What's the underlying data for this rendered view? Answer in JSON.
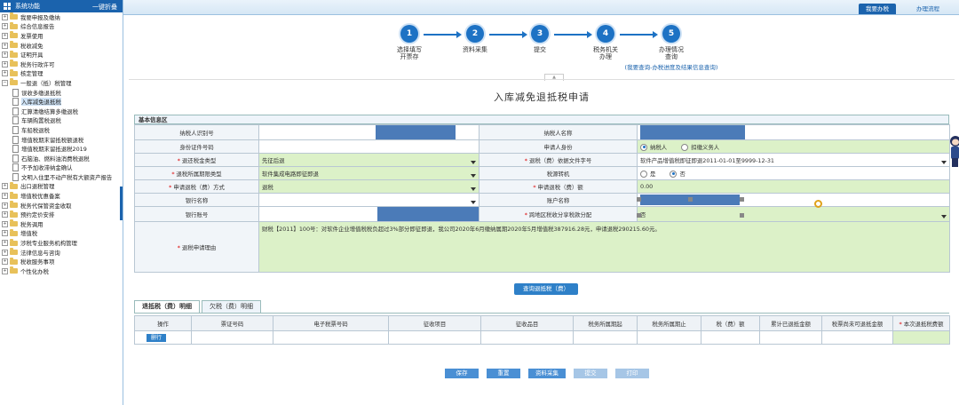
{
  "sidebar": {
    "title": "系统功能",
    "expand_all": "一键折叠",
    "items": [
      {
        "label": "我要申报及缴纳",
        "type": "folder",
        "level": 0
      },
      {
        "label": "综合信息报告",
        "type": "folder",
        "level": 0
      },
      {
        "label": "发票使用",
        "type": "folder",
        "level": 0
      },
      {
        "label": "税收减免",
        "type": "folder",
        "level": 0
      },
      {
        "label": "证明开具",
        "type": "folder",
        "level": 0
      },
      {
        "label": "税务行政许可",
        "type": "folder",
        "level": 0
      },
      {
        "label": "核定管理",
        "type": "folder",
        "level": 0
      },
      {
        "label": "一般退（抵）税管理",
        "type": "folder",
        "level": 0,
        "expanded": true
      },
      {
        "label": "误收多缴退抵税",
        "type": "doc",
        "level": 1
      },
      {
        "label": "入库减免退抵税",
        "type": "doc",
        "level": 1,
        "active": true
      },
      {
        "label": "汇算清缴结算多缴退税",
        "type": "doc",
        "level": 1
      },
      {
        "label": "车辆购置税退税",
        "type": "doc",
        "level": 1
      },
      {
        "label": "车船税退税",
        "type": "doc",
        "level": 1
      },
      {
        "label": "增值税期末留抵税额退税",
        "type": "doc",
        "level": 1
      },
      {
        "label": "增值税期末留抵退税2019",
        "type": "doc",
        "level": 1
      },
      {
        "label": "石脑油、燃料油消费税退税",
        "type": "doc",
        "level": 1
      },
      {
        "label": "不予加收滞纳金确认",
        "type": "doc",
        "level": 1
      },
      {
        "label": "文明入住里不动产税有大额资产报告",
        "type": "doc",
        "level": 1
      },
      {
        "label": "出口退税管理",
        "type": "folder",
        "level": 0
      },
      {
        "label": "增值税优惠备案",
        "type": "folder",
        "level": 0
      },
      {
        "label": "税务代保管资金收取",
        "type": "folder",
        "level": 0
      },
      {
        "label": "预约定价安排",
        "type": "folder",
        "level": 0
      },
      {
        "label": "税务调用",
        "type": "folder",
        "level": 0
      },
      {
        "label": "增值税",
        "type": "folder",
        "level": 0
      },
      {
        "label": "涉税专业服务机构管理",
        "type": "folder",
        "level": 0
      },
      {
        "label": "法律信息与咨询",
        "type": "folder",
        "level": 0
      },
      {
        "label": "税收服务事项",
        "type": "folder",
        "level": 0
      },
      {
        "label": "个性化办税",
        "type": "folder",
        "level": 0
      }
    ]
  },
  "topbar": {
    "tabs": [
      "我要办税",
      "办理流程"
    ]
  },
  "steps": {
    "items": [
      {
        "num": "1",
        "label": "选择填写\n开票存"
      },
      {
        "num": "2",
        "label": "资料采集"
      },
      {
        "num": "3",
        "label": "提交"
      },
      {
        "num": "4",
        "label": "税务机关\n办理"
      },
      {
        "num": "5",
        "label": "办理情况\n查询"
      }
    ],
    "link": "(我要查询-办税进度及结果信息查询)"
  },
  "form": {
    "title": "入库减免退抵税申请",
    "section": "基本信息区",
    "labels": {
      "taxpayer_id": "纳税人识别号",
      "taxpayer_name": "纳税人名称",
      "id_number": "身份证件号码",
      "applicant_identity": "申请人身份",
      "return_type": "退还税金类型",
      "doc_no": "退税（费）依据文件字号",
      "period_type": "退税所属期限类型",
      "tax_agency": "税源转机",
      "method": "申请退税（费）方式",
      "amount": "申请退税（费）额",
      "bank_name": "银行名称",
      "account_name": "账户名称",
      "bank_account": "银行账号",
      "regional_share": "跨地区税收分享税款分配",
      "reason": "退税申请理由"
    },
    "values": {
      "return_type": "先征后退",
      "doc_no": "软件产品增值税即征即退2011-01-01至9999-12-31",
      "period_type": "软件集成电路即征即退",
      "method": "退税",
      "amount": "0.00",
      "regional_share": "否",
      "reason": "财税【2011】100号：对软件企业增值税税负超过3%部分即征即退，我公司2020年6月缴纳属期2020年5月增值税387916.28元，申请退税290215.60元。"
    },
    "applicant_options": [
      {
        "label": "纳税人",
        "selected": true
      },
      {
        "label": "扣缴义务人",
        "selected": false
      }
    ],
    "agency_options": [
      {
        "label": "是",
        "selected": false
      },
      {
        "label": "否",
        "selected": true
      }
    ]
  },
  "query_button": "查询退抵税（费）",
  "detail": {
    "tabs": [
      "退抵税（费）明细",
      "欠税（费）明细"
    ],
    "headers": [
      "操作",
      "票证号码",
      "电子税票号码",
      "征收项目",
      "征收品目",
      "税务所属期起",
      "税务所属期止",
      "税（费）额",
      "累计已退抵金额",
      "税票尚未可退抵金额",
      "本次退抵税费额"
    ],
    "row_button": "删行"
  },
  "actions": [
    {
      "label": "保存",
      "disabled": false
    },
    {
      "label": "重置",
      "disabled": false
    },
    {
      "label": "资料采集",
      "disabled": false
    },
    {
      "label": "提交",
      "disabled": true
    },
    {
      "label": "打印",
      "disabled": true
    }
  ]
}
